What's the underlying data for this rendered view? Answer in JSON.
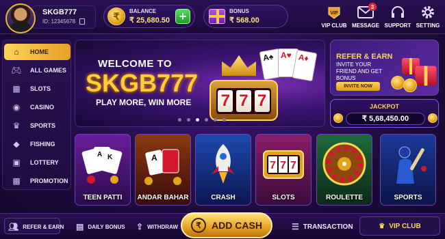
{
  "user": {
    "name": "SKGB777",
    "id_text": "ID: 12345678"
  },
  "balance": {
    "label": "BALANCE",
    "value": "₹ 25,680.50",
    "coin_symbol": "₹",
    "add_symbol": "+"
  },
  "bonus": {
    "label": "BONUS",
    "value": "₹ 568.00"
  },
  "top_nav": [
    {
      "label": "VIP CLUB",
      "icon": "vip-icon"
    },
    {
      "label": "MESSAGE",
      "icon": "mail-icon",
      "badge": "3"
    },
    {
      "label": "SUPPORT",
      "icon": "headset-icon"
    },
    {
      "label": "SETTING",
      "icon": "gear-icon"
    }
  ],
  "sidebar": {
    "items": [
      {
        "label": "HOME",
        "icon": "home-icon",
        "active": true
      },
      {
        "label": "ALL GAMES",
        "icon": "gamepad-icon"
      },
      {
        "label": "SLOTS",
        "icon": "slot-icon"
      },
      {
        "label": "CASINO",
        "icon": "chip-icon"
      },
      {
        "label": "SPORTS",
        "icon": "trophy-icon"
      },
      {
        "label": "FISHING",
        "icon": "fish-icon"
      },
      {
        "label": "LOTTERY",
        "icon": "ticket-icon"
      },
      {
        "label": "PROMOTION",
        "icon": "gift-icon"
      }
    ]
  },
  "banner": {
    "welcome": "WELCOME TO",
    "brand": "SKGB777",
    "tagline": "PLAY MORE, WIN MORE",
    "slot_digits": [
      "7",
      "7",
      "7"
    ],
    "cards": [
      "A♠",
      "A♥",
      "A♦"
    ],
    "active_dot": 2
  },
  "refer": {
    "title": "REFER & EARN",
    "subtitle": "INVITE YOUR FRIEND AND GET BONUS",
    "button": "INVITE NOW"
  },
  "jackpot": {
    "title": "JACKPOT",
    "value": "₹ 5,68,450.00"
  },
  "games": [
    {
      "label": "TEEN PATTI",
      "colors": [
        "#6a1d9a",
        "#2a0b4a"
      ]
    },
    {
      "label": "ANDAR BAHAR",
      "colors": [
        "#8a3a12",
        "#3a0b0b"
      ]
    },
    {
      "label": "CRASH",
      "colors": [
        "#1d4ab0",
        "#0b1650"
      ]
    },
    {
      "label": "SLOTS",
      "colors": [
        "#8a1d6a",
        "#3a0b3a"
      ]
    },
    {
      "label": "ROULETTE",
      "colors": [
        "#1d6a3a",
        "#0b2a18"
      ]
    },
    {
      "label": "SPORTS",
      "colors": [
        "#1d3a9a",
        "#0b1545"
      ]
    }
  ],
  "bottom_nav": {
    "refer": "REFER & EARN",
    "daily_bonus": "DAILY BONUS",
    "withdraw": "WITHDRAW",
    "add_cash": "ADD CASH",
    "add_cash_symbol": "₹",
    "transaction": "TRANSACTION",
    "vip_club": "VIP CLUB"
  },
  "colors": {
    "gold": "#ffcd3c",
    "accent_green": "#1e9a2a",
    "bg": "#1d0b3c"
  }
}
